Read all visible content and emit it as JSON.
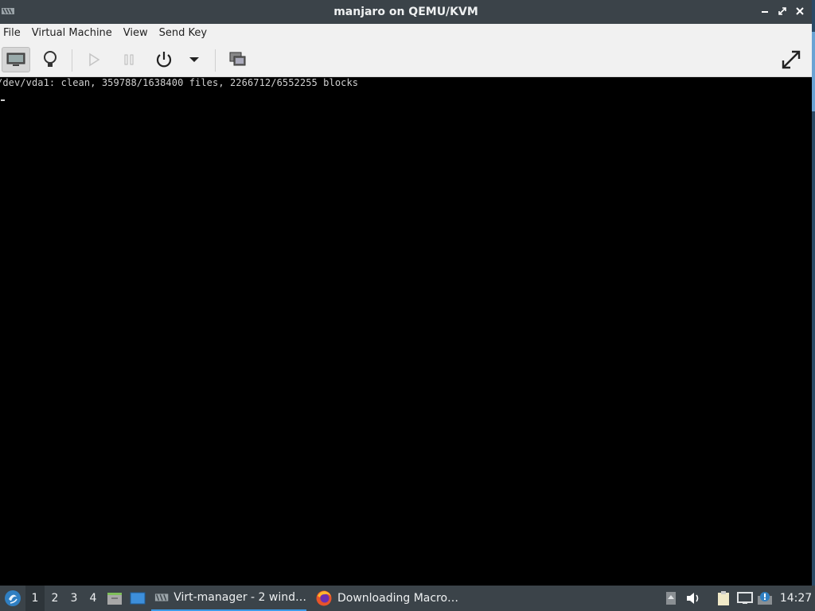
{
  "window": {
    "title": "manjaro on QEMU/KVM",
    "controls": [
      "minimize",
      "maximize",
      "close"
    ]
  },
  "menu": {
    "items": [
      "File",
      "Virtual Machine",
      "View",
      "Send Key"
    ]
  },
  "toolbar": {
    "buttons": [
      {
        "icon": "console-monitor-icon",
        "active": true
      },
      {
        "icon": "details-lightbulb-icon",
        "active": false
      },
      {
        "icon": "run-play-icon",
        "enabled": false
      },
      {
        "icon": "pause-icon",
        "enabled": false
      },
      {
        "icon": "power-icon",
        "enabled": true
      },
      {
        "icon": "power-menu-chevron-icon",
        "enabled": true
      },
      {
        "icon": "snapshots-icon",
        "enabled": true
      },
      {
        "icon": "fullscreen-icon",
        "enabled": true
      }
    ]
  },
  "console": {
    "line1": "/dev/vda1: clean, 359788/1638400 files, 2266712/6552255 blocks"
  },
  "taskbar": {
    "workspaces": [
      "1",
      "2",
      "3",
      "4"
    ],
    "active_workspace": "1",
    "tasks": [
      {
        "label": "Virt-manager - 2 wind…",
        "icon": "virt-manager-icon",
        "active": true
      },
      {
        "label": "Downloading Macro…",
        "icon": "firefox-icon",
        "active": false
      }
    ],
    "clock": "14:27",
    "colors": {
      "bar": "#3b4349",
      "accent": "#3d9be9"
    }
  }
}
